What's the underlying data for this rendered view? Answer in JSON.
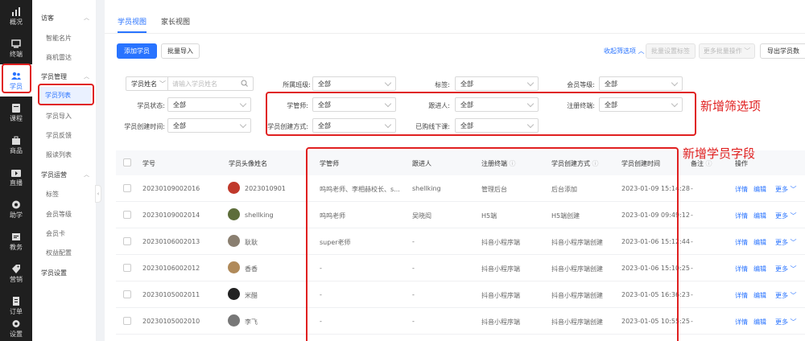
{
  "rail": [
    {
      "label": "概况",
      "icon": "bar-chart-icon"
    },
    {
      "label": "终端",
      "icon": "terminal-icon"
    },
    {
      "label": "学员",
      "icon": "students-icon"
    },
    {
      "label": "课程",
      "icon": "course-icon"
    },
    {
      "label": "商品",
      "icon": "goods-icon"
    },
    {
      "label": "直播",
      "icon": "live-icon"
    },
    {
      "label": "助学",
      "icon": "assist-icon"
    },
    {
      "label": "教务",
      "icon": "academic-icon"
    },
    {
      "label": "营销",
      "icon": "marketing-icon"
    },
    {
      "label": "订单",
      "icon": "order-icon"
    },
    {
      "label": "设置",
      "icon": "settings-icon"
    }
  ],
  "submenu": {
    "groups": [
      {
        "title": "访客",
        "items": [
          "智能名片",
          "商机雷达"
        ]
      },
      {
        "title": "学员管理",
        "items": [
          "学员列表",
          "学员导入",
          "学员反馈",
          "报读列表"
        ]
      },
      {
        "title": "学员运营",
        "items": [
          "标签",
          "会员等级",
          "会员卡",
          "权益配置"
        ]
      },
      {
        "title": "学员设置",
        "items": []
      }
    ],
    "active_item": "学员列表"
  },
  "tabs": [
    "学员视图",
    "家长视图"
  ],
  "toolbar": {
    "add_student": "添加学员",
    "batch_import": "批量导入",
    "collapse_filters": "收起筛选项",
    "batch_tag": "批量设置标签",
    "more_batch": "更多批量操作",
    "export": "导出学员数"
  },
  "filters": {
    "name_select": "学员姓名",
    "name_placeholder": "请输入学员姓名",
    "class_label": "所属班级:",
    "tag_label": "标签:",
    "level_label": "会员等级:",
    "status_label": "学员状态:",
    "manager_label": "学管师:",
    "follower_label": "跟进人:",
    "terminal_label": "注册终端:",
    "created_time_label": "学员创建时间:",
    "create_method_label": "学员创建方式:",
    "purchase_label": "已购线下课:",
    "all": "全部"
  },
  "table": {
    "headers": {
      "id": "学号",
      "avatar_name": "学员头像姓名",
      "manager": "学管师",
      "follower": "跟进人",
      "terminal": "注册终端",
      "method": "学员创建方式",
      "created": "学员创建时间",
      "remark": "备注",
      "ops": "操作"
    },
    "rows": [
      {
        "id": "20230109002016",
        "name": "2023010901",
        "manager": "呜呜老师、李相赫校长、s...",
        "follower": "shellking",
        "terminal": "管理后台",
        "method": "后台添加",
        "created": "2023-01-09 15:14:28",
        "remark": "-"
      },
      {
        "id": "20230109002014",
        "name": "shellking",
        "manager": "呜呜老师",
        "follower": "吴晓闳",
        "terminal": "H5端",
        "method": "H5端创建",
        "created": "2023-01-09 09:49:12",
        "remark": "-"
      },
      {
        "id": "20230106002013",
        "name": "耿耿",
        "manager": "super老师",
        "follower": "-",
        "terminal": "抖音小程序端",
        "method": "抖音小程序端创建",
        "created": "2023-01-06 15:12:44",
        "remark": "-"
      },
      {
        "id": "20230106002012",
        "name": "香香",
        "manager": "-",
        "follower": "-",
        "terminal": "抖音小程序端",
        "method": "抖音小程序端创建",
        "created": "2023-01-06 15:10:25",
        "remark": "-"
      },
      {
        "id": "20230105002011",
        "name": "米醋",
        "manager": "-",
        "follower": "-",
        "terminal": "抖音小程序端",
        "method": "抖音小程序端创建",
        "created": "2023-01-05 16:36:23",
        "remark": "-"
      },
      {
        "id": "20230105002010",
        "name": "李飞",
        "manager": "-",
        "follower": "-",
        "terminal": "抖音小程序端",
        "method": "抖音小程序端创建",
        "created": "2023-01-05 10:55:25",
        "remark": "-"
      }
    ],
    "op_detail": "详情",
    "op_edit": "编辑",
    "op_more": "更多"
  },
  "annotations": {
    "filters_note": "新增筛选项",
    "fields_note": "新增学员字段"
  },
  "colors": {
    "accent": "#2873ff",
    "annotation": "#e02020",
    "rail": "#1f1f1f"
  }
}
